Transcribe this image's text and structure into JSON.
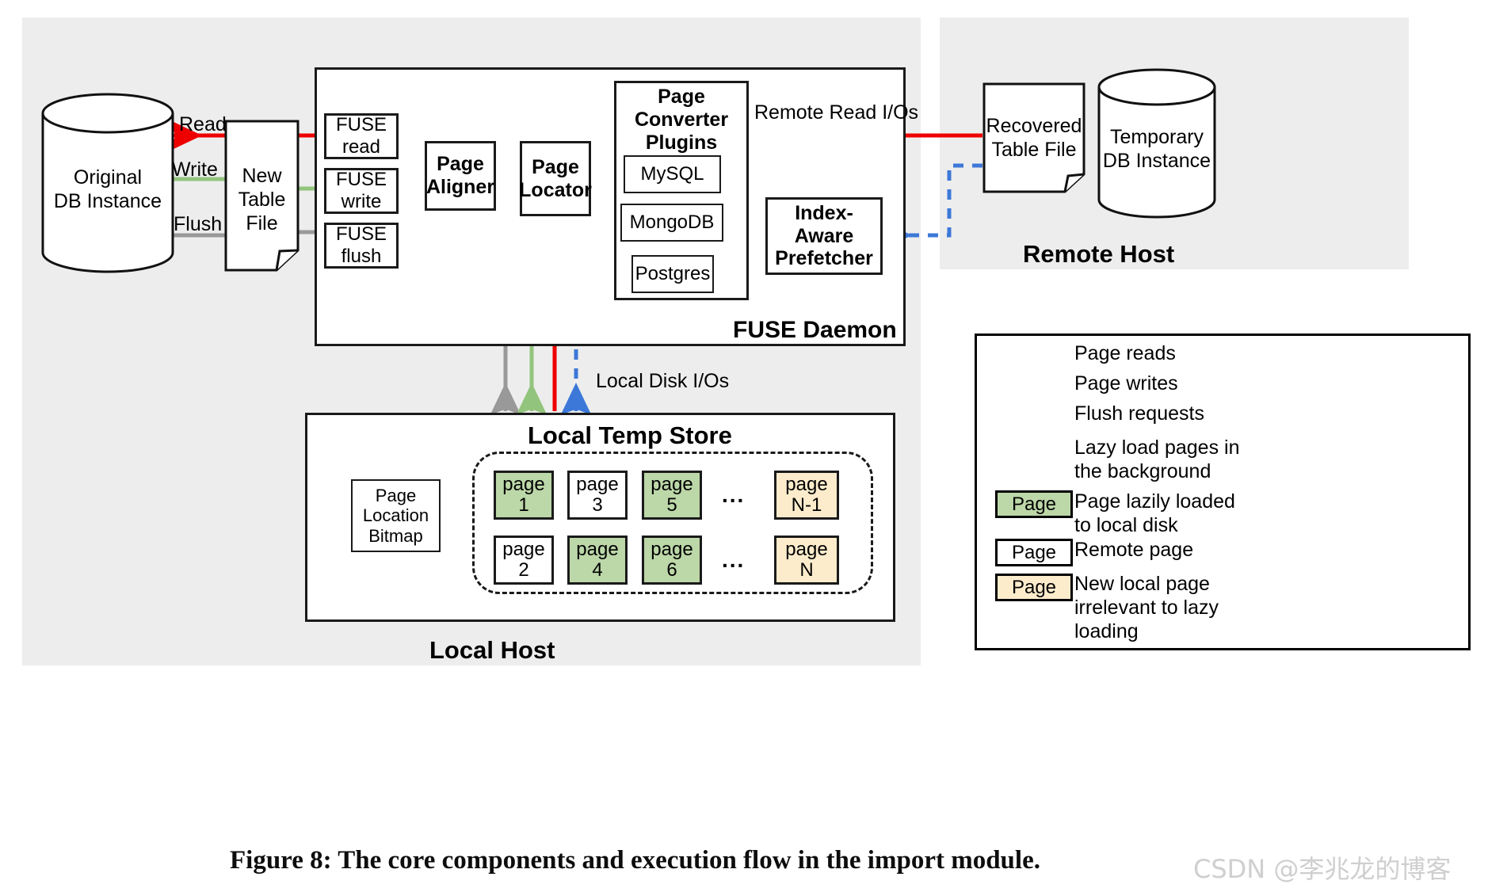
{
  "figure": {
    "caption": "Figure 8: The core components and execution flow in the import module.",
    "watermark": "CSDN @李兆龙的博客"
  },
  "hosts": {
    "local": {
      "label": "Local Host"
    },
    "remote": {
      "label": "Remote Host"
    }
  },
  "left": {
    "original_db": "Original\nDB Instance",
    "original_db_line1": "Original",
    "original_db_line2": "DB Instance",
    "new_table_file_line1": "New",
    "new_table_file_line2": "Table File",
    "edge_read": "Read",
    "edge_write": "Write",
    "edge_flush": "Flush"
  },
  "fuse_daemon": {
    "title": "FUSE Daemon",
    "fuse_read_line1": "FUSE",
    "fuse_read_line2": "read",
    "fuse_write_line1": "FUSE",
    "fuse_write_line2": "write",
    "fuse_flush_line1": "FUSE",
    "fuse_flush_line2": "flush",
    "page_aligner_line1": "Page",
    "page_aligner_line2": "Aligner",
    "page_locator_line1": "Page",
    "page_locator_line2": "Locator",
    "converter": {
      "title_line1": "Page",
      "title_line2": "Converter",
      "title_line3": "Plugins",
      "plugins": [
        "MySQL",
        "MongoDB",
        "Postgres"
      ]
    },
    "prefetcher_line1": "Index-Aware",
    "prefetcher_line2": "Prefetcher"
  },
  "edges": {
    "remote_read_ios": "Remote Read I/Os",
    "local_disk_ios": "Local Disk I/Os"
  },
  "remote": {
    "recovered_table_file_line1": "Recovered",
    "recovered_table_file_line2": "Table File",
    "temporary_db_line1": "Temporary",
    "temporary_db_line2": "DB Instance"
  },
  "temp_store": {
    "title": "Local Temp Store",
    "bitmap_line1": "Page",
    "bitmap_line2": "Location",
    "bitmap_line3": "Bitmap",
    "ellipsis": "...",
    "row1": [
      {
        "word": "page",
        "num": "1",
        "fill": "green"
      },
      {
        "word": "page",
        "num": "3",
        "fill": "white"
      },
      {
        "word": "page",
        "num": "5",
        "fill": "green"
      },
      {
        "word": "page",
        "num": "N-1",
        "fill": "yellow"
      }
    ],
    "row2": [
      {
        "word": "page",
        "num": "2",
        "fill": "white"
      },
      {
        "word": "page",
        "num": "4",
        "fill": "green"
      },
      {
        "word": "page",
        "num": "6",
        "fill": "green"
      },
      {
        "word": "page",
        "num": "N",
        "fill": "yellow"
      }
    ]
  },
  "legend": {
    "rows": [
      {
        "kind": "arrow",
        "style": "solid",
        "color": "#ee0000",
        "label": "Page reads"
      },
      {
        "kind": "arrow",
        "style": "solid",
        "color": "#93c47d",
        "label": "Page writes"
      },
      {
        "kind": "arrow",
        "style": "solid",
        "color": "#999999",
        "label": "Flush requests"
      },
      {
        "kind": "arrow",
        "style": "dashed",
        "color": "#3c78d8",
        "label": "Lazy load pages in\nthe background"
      },
      {
        "kind": "swatch",
        "fill": "#bcd7a8",
        "swatch_label": "Page",
        "label": "Page lazily loaded\nto local disk"
      },
      {
        "kind": "swatch",
        "fill": "#ffffff",
        "swatch_label": "Page",
        "label": "Remote page"
      },
      {
        "kind": "swatch",
        "fill": "#fdeccc",
        "swatch_label": "Page",
        "label": "New local page\nirrelevant to lazy\nloading"
      }
    ],
    "l0": "Page reads",
    "l1": "Page writes",
    "l2": "Flush requests",
    "l3a": "Lazy load pages in",
    "l3b": "the background",
    "l4a": "Page lazily loaded",
    "l4b": "to local disk",
    "l5": "Remote page",
    "l6a": "New local page",
    "l6b": "irrelevant to lazy",
    "l6c": "loading",
    "swatch_word": "Page"
  },
  "colors": {
    "read": "#ee0000",
    "write": "#93c47d",
    "flush": "#999999",
    "lazy": "#3c78d8",
    "page_green": "#bcd7a8",
    "page_yellow": "#fdeccc",
    "host_bg": "#ededed",
    "stroke": "#1a1a1a"
  }
}
